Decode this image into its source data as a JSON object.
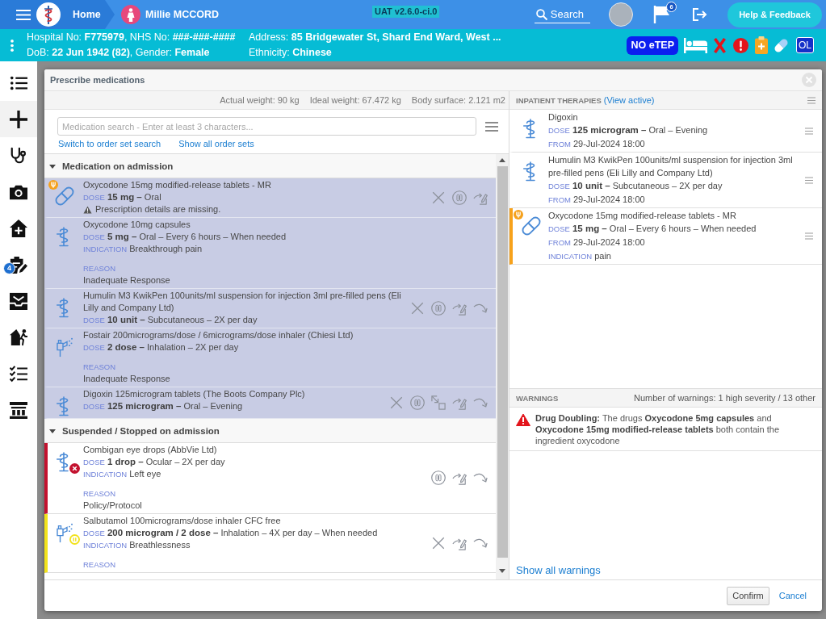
{
  "top_bar": {
    "home": "Home",
    "patient_name": "Millie MCCORD",
    "environment": "UAT v2.6.0-ci.0",
    "search": "Search",
    "notification_count": "6",
    "help_button": "Help & Feedback"
  },
  "patient_banner": {
    "identity": [
      "Hospital No: **F775979**, NHS No: **###-###-####**",
      "DoB: **22 Jun 1942 (82)**, Gender: **Female**"
    ],
    "address": [
      "Address: **85 Bridgewater St, Shard End Ward, West ...**",
      "Ethnicity: **Chinese**"
    ],
    "etep_badge": "NO eTEP",
    "flags": [
      {
        "kind": "bed"
      },
      {
        "kind": "stop"
      },
      {
        "kind": "alert"
      },
      {
        "kind": "clipboard"
      },
      {
        "kind": "pill"
      }
    ],
    "ol_badge": "OL"
  },
  "sidebar": {
    "items": [
      {
        "kind": "list",
        "selected": false
      },
      {
        "kind": "add",
        "selected": true
      },
      {
        "kind": "stethoscope",
        "selected": false
      },
      {
        "kind": "camera",
        "selected": false
      },
      {
        "kind": "home",
        "selected": false
      },
      {
        "kind": "notes",
        "selected": false,
        "badge": "4"
      },
      {
        "kind": "inbox",
        "selected": false
      },
      {
        "kind": "discharge",
        "selected": false
      },
      {
        "kind": "checklist",
        "selected": false
      },
      {
        "kind": "building",
        "selected": false
      }
    ]
  },
  "dialog": {
    "title": "Prescribe medications",
    "measurements": [
      "Actual weight: 90 kg",
      "Ideal weight: 67.472 kg",
      "Body surface: 2.121 m2"
    ],
    "search": {
      "placeholder": "Medication search - Enter at least 3 characters..."
    },
    "links": [
      "Switch to order set search",
      "Show all order sets"
    ],
    "sections": [
      {
        "title": "Medication on admission",
        "expanded": true,
        "items": [
          {
            "kind": "capsule",
            "name": "Oxycodone 15mg modified-release tablets - MR",
            "selected": true,
            "stopped": false,
            "suspended": false,
            "controlled": true,
            "details": [
              {
                "label": "DOSE",
                "value": "**15 mg –** Oral"
              }
            ],
            "notice": "Prescription details are missing.",
            "actions": [
              {
                "kind": "stop"
              },
              {
                "kind": "suspend"
              },
              {
                "kind": "modify"
              }
            ]
          },
          {
            "kind": "generic",
            "name": "Oxycodone 10mg capsules",
            "selected": true,
            "stopped": false,
            "suspended": false,
            "controlled": false,
            "details": [
              {
                "label": "DOSE",
                "value": "**5 mg –** Oral – Every 6 hours – When needed"
              },
              {
                "label": "INDICATION",
                "value": "Breakthrough pain"
              }
            ],
            "reason": {
              "label": "REASON",
              "value": "Inadequate Response"
            }
          },
          {
            "kind": "generic",
            "name": "Humulin M3 KwikPen 100units/ml suspension for injection 3ml pre-filled pens (Eli Lilly and Company Ltd)",
            "selected": true,
            "stopped": false,
            "suspended": false,
            "controlled": false,
            "details": [
              {
                "label": "DOSE",
                "value": "**10 unit –** Subcutaneous – 2X per day"
              }
            ],
            "actions": [
              {
                "kind": "stop"
              },
              {
                "kind": "suspend"
              },
              {
                "kind": "modify"
              },
              {
                "kind": "continue"
              }
            ]
          },
          {
            "kind": "inhaler",
            "name": "Fostair 200micrograms/dose / 6micrograms/dose inhaler (Chiesi Ltd)",
            "selected": true,
            "stopped": false,
            "suspended": false,
            "controlled": false,
            "details": [
              {
                "label": "DOSE",
                "value": "**2 dose –** Inhalation – 2X per day"
              }
            ],
            "reason": {
              "label": "REASON",
              "value": "Inadequate Response"
            }
          },
          {
            "kind": "generic",
            "name": "Digoxin 125microgram tablets (The Boots Company Plc)",
            "selected": true,
            "stopped": false,
            "suspended": false,
            "controlled": false,
            "details": [
              {
                "label": "DOSE",
                "value": "**125 microgram –** Oral – Evening"
              }
            ],
            "actions": [
              {
                "kind": "stop"
              },
              {
                "kind": "suspend"
              },
              {
                "kind": "convert"
              },
              {
                "kind": "modify"
              },
              {
                "kind": "continue"
              }
            ]
          }
        ]
      },
      {
        "title": "Suspended / Stopped on admission",
        "expanded": true,
        "items": [
          {
            "kind": "generic",
            "name": "Combigan eye drops (AbbVie Ltd)",
            "selected": false,
            "stopped": true,
            "suspended": false,
            "controlled": false,
            "details": [
              {
                "label": "DOSE",
                "value": "**1 drop –** Ocular – 2X per day"
              },
              {
                "label": "INDICATION",
                "value": "Left eye"
              }
            ],
            "reason": {
              "label": "REASON",
              "value": "Policy/Protocol"
            },
            "actions": [
              {
                "kind": "suspend"
              },
              {
                "kind": "modify"
              },
              {
                "kind": "continue"
              }
            ]
          },
          {
            "kind": "inhaler",
            "name": "Salbutamol 100micrograms/dose inhaler CFC free",
            "selected": false,
            "stopped": false,
            "suspended": true,
            "controlled": false,
            "details": [
              {
                "label": "DOSE",
                "value": "**200 microgram / 2 dose –** Inhalation – 4X per day – When needed"
              },
              {
                "label": "INDICATION",
                "value": "Breathlessness"
              }
            ],
            "reason": {
              "label": "REASON"
            },
            "actions": [
              {
                "kind": "stop"
              },
              {
                "kind": "modify"
              },
              {
                "kind": "continue"
              }
            ]
          }
        ]
      }
    ],
    "inpatient_therapies": {
      "title": "INPATIENT THERAPIES",
      "link": "(View active)",
      "items": [
        {
          "kind": "generic",
          "name": "Digoxin",
          "controlled": false,
          "details": [
            {
              "label": "DOSE",
              "value": "**125 microgram –** Oral – Evening"
            },
            {
              "label": "FROM",
              "value": "29-Jul-2024 18:00"
            }
          ]
        },
        {
          "kind": "generic",
          "name": "Humulin M3 KwikPen 100units/ml suspension for injection 3ml pre-filled pens (Eli Lilly and Company Ltd)",
          "controlled": false,
          "details": [
            {
              "label": "DOSE",
              "value": "**10 unit –** Subcutaneous – 2X per day"
            },
            {
              "label": "FROM",
              "value": "29-Jul-2024 18:00"
            }
          ]
        },
        {
          "kind": "capsule",
          "name": "Oxycodone 15mg modified-release tablets - MR",
          "controlled": true,
          "details": [
            {
              "label": "DOSE",
              "value": "**15 mg –** Oral – Every 6 hours – When needed"
            },
            {
              "label": "FROM",
              "value": "29-Jul-2024 18:00"
            },
            {
              "label": "INDICATION",
              "value": "pain"
            }
          ]
        }
      ]
    },
    "warnings": {
      "title": "WARNINGS",
      "summary": "Number of warnings: 1 high severity / 13 other",
      "items": [
        {
          "kind": "high",
          "text": "**Drug Doubling:** The drugs **Oxycodone 5mg capsules** and **Oxycodone 15mg modified-release tablets** both contain the ingredient oxycodone"
        }
      ],
      "show_all": "Show all warnings"
    },
    "buttons": [
      {
        "kind": "primary",
        "label": "Confirm"
      },
      {
        "kind": "link",
        "label": "Cancel"
      }
    ]
  }
}
